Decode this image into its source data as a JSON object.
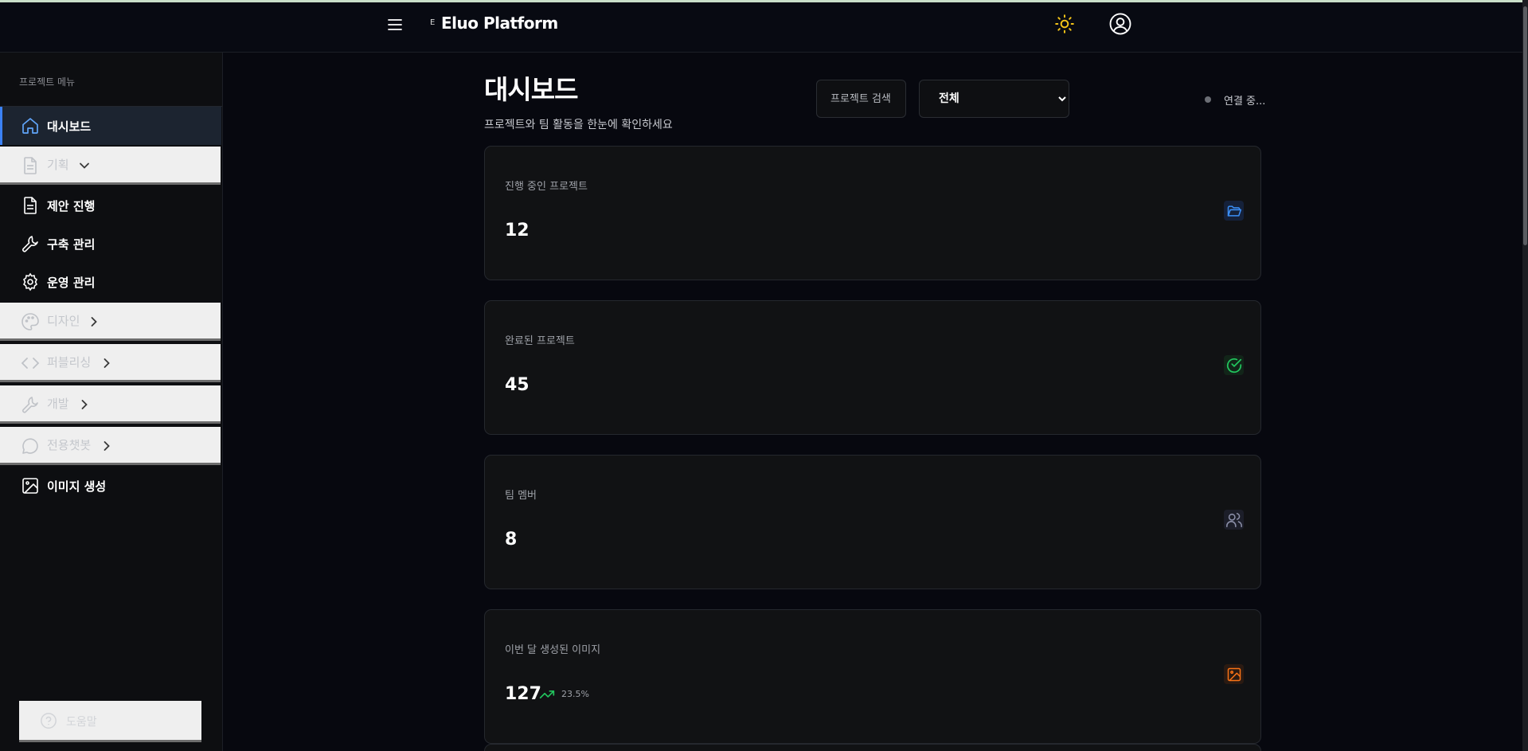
{
  "header": {
    "logo_mark": "E",
    "app_title": "Eluo Platform",
    "icons": {
      "menu": "hamburger-icon",
      "theme": "sun-icon",
      "user": "user-circle-icon"
    },
    "sun_color": "#f5c518"
  },
  "sidebar": {
    "heading": "프로젝트 메뉴",
    "items": [
      {
        "label": "대시보드",
        "icon": "home-icon",
        "active": true
      },
      {
        "label": "기획",
        "icon": "document-icon",
        "group": true,
        "expanded": true
      },
      {
        "label": "제안 진행",
        "icon": "document-icon"
      },
      {
        "label": "구축 관리",
        "icon": "wrench-icon"
      },
      {
        "label": "운영 관리",
        "icon": "gear-icon"
      },
      {
        "label": "디자인",
        "icon": "palette-icon",
        "group": true,
        "expanded": false
      },
      {
        "label": "퍼블리싱",
        "icon": "code-icon",
        "group": true,
        "expanded": false
      },
      {
        "label": "개발",
        "icon": "wrench-icon",
        "group": true,
        "expanded": false
      },
      {
        "label": "전용챗봇",
        "icon": "chat-icon",
        "group": true,
        "expanded": false
      },
      {
        "label": "이미지 생성",
        "icon": "image-icon"
      }
    ],
    "help_label": "도움말"
  },
  "main": {
    "title": "대시보드",
    "subtitle": "프로젝트와 팀 활동을 한눈에 확인하세요",
    "search_placeholder": "프로젝트 검색",
    "filter": {
      "selected": "전체",
      "options": [
        "전체"
      ]
    },
    "connection_status": "연결 중...",
    "cards": [
      {
        "label": "진행 중인 프로젝트",
        "value": "12",
        "icon": "folder-open-icon",
        "color": "#3b8ff6"
      },
      {
        "label": "완료된 프로젝트",
        "value": "45",
        "icon": "check-circle-icon",
        "color": "#22c55e"
      },
      {
        "label": "팀 멤버",
        "value": "8",
        "icon": "users-icon",
        "color": "#8b8fa8"
      },
      {
        "label": "이번 달 생성된 이미지",
        "value": "127",
        "icon": "image-icon",
        "color": "#f97316",
        "trend": "23.5%",
        "trend_color": "#22c55e"
      }
    ]
  }
}
